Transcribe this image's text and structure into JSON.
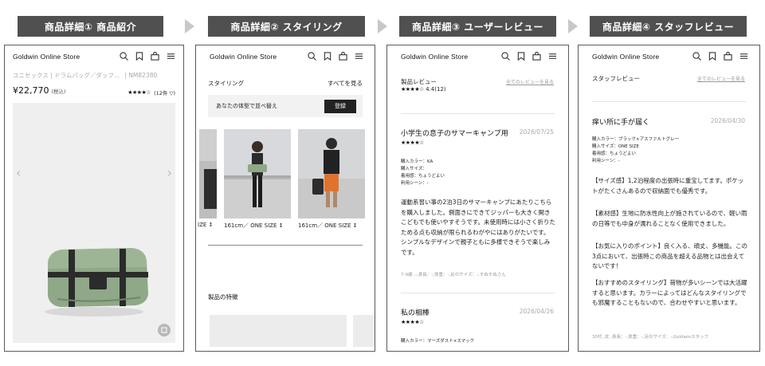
{
  "headers": [
    "商品詳細① 商品紹介",
    "商品詳細② スタイリング",
    "商品詳細③ ユーザーレビュー",
    "商品詳細④ スタッフレビュー"
  ],
  "brand": "Goldwin Online Store",
  "product": {
    "subtitle": "ユニセックス | ドラムバッグ／ダッフ...",
    "code": "| NM82380",
    "price": "¥22,770",
    "tax": "(税込)",
    "stars": "★★★★☆",
    "review_count": "(12件 ▽)"
  },
  "styling": {
    "title": "スタイリング",
    "see_all": "すべてを見る",
    "compare_text": "あなたの体型で並べ替え",
    "register": "登録",
    "captions": [
      "IZE ↕",
      "161cm／ ONE SIZE ↕",
      "161cm／ ONE SIZE ↕"
    ],
    "features_title": "製品の特徴"
  },
  "user_reviews": {
    "title": "製品レビュー",
    "all_link": "全てのレビューを見る",
    "stars": "★★★★☆",
    "score": "4.4(12)",
    "review1": {
      "title": "小学生の息子のサマーキャンプ用",
      "date": "2026/07/25",
      "stars": "★★★★☆",
      "meta": [
        "購入カラー：KA",
        "購入サイズ：",
        "着用感：ちょうどよい",
        "利用シーン：-"
      ],
      "body": "運動系習い事の2泊3日のサマーキャンプにあたりこちらを購入しました。側面きにできてジッパーも大きく開きこどもでも使いやすそうです。未使用時には小さく折りたためる点も収納が限られるわがやにはありがたいです。シンプルなデザインで親子ともに多様できそうで楽しみです。",
      "footer": "7-9歳 ,-,身長：-,体重：-,足のサイズ：-,すぬすぬさん"
    },
    "review2": {
      "title": "私の相棒",
      "date": "2026/04/26",
      "stars": "★★★★☆",
      "meta": [
        "購入カラー：マーズダスト×スマック"
      ]
    }
  },
  "staff_reviews": {
    "title": "スタッフレビュー",
    "all_link": "全てのレビューを見る",
    "review": {
      "title": "痒い所に手が届く",
      "date": "2026/04/30",
      "meta": [
        "購入カラー：ブラック×アスファルトグレー",
        "購入サイズ：ONE SIZE",
        "着用感：ちょうどよい",
        "利用シーン：-"
      ],
      "paragraphs": [
        "【サイズ感】1,2泊程度の出張時に重宝してます。ポケットがたくさんあるので収納面でも優秀です。",
        "【素材感】生地に防水性向上が施されているので、軽い雨の日等でも中身が濡れることなく使用できました。",
        "【お気に入りのポイント】良く入る、頑丈、多機能。この3点において、出張時この商品を超える品物とは出会えてないです！",
        "【おすすめのスタイリング】荷物が多いシーンでは大活躍すると思います。カラーによってはどんなスタイリングでも邪魔することもないので、合わせやすいと思います。"
      ],
      "footer": "30代 ,女 ,身長：-,体重：-,足のサイズ：-,Goldwinスタッフ"
    }
  },
  "colors": {
    "header_bg": "#505050",
    "arrow": "#c8c8c8",
    "bag": "#8fa887"
  }
}
